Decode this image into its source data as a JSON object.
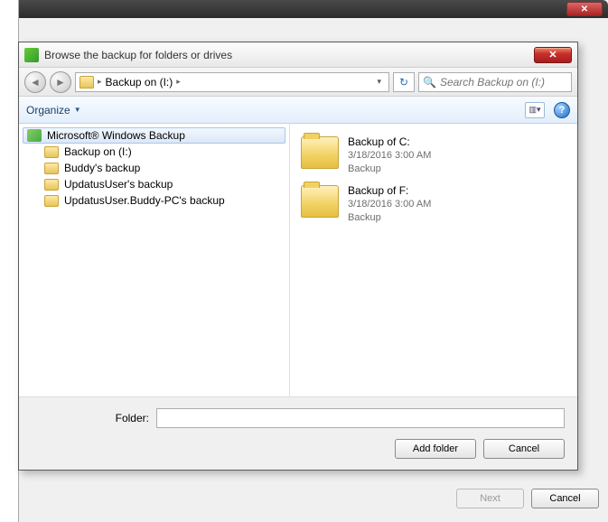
{
  "outerWindow": {
    "closeGlyph": "✕",
    "buttons": {
      "next": "Next",
      "cancel": "Cancel"
    }
  },
  "dialog": {
    "title": "Browse the backup for folders or drives",
    "closeGlyph": "✕"
  },
  "nav": {
    "backGlyph": "◄",
    "fwdGlyph": "►",
    "crumbSep": "▸",
    "location": "Backup on (I:)",
    "dropdownGlyph": "▾",
    "refreshGlyph": "↻",
    "search": {
      "icon": "🔍",
      "placeholder": "Search Backup on (I:)"
    }
  },
  "toolbar": {
    "organize": "Organize",
    "organizeGlyph": "▼",
    "viewGlyph": "▥▾",
    "helpGlyph": "?"
  },
  "tree": {
    "root": "Microsoft® Windows Backup",
    "children": [
      "Backup on (I:)",
      "Buddy's backup",
      "UpdatusUser's backup",
      "UpdatusUser.Buddy-PC's backup"
    ]
  },
  "items": [
    {
      "name": "Backup of C:",
      "date": "3/18/2016 3:00 AM",
      "type": "Backup"
    },
    {
      "name": "Backup of F:",
      "date": "3/18/2016 3:00 AM",
      "type": "Backup"
    }
  ],
  "footer": {
    "folderLabel": "Folder:",
    "folderValue": "",
    "addFolder": "Add folder",
    "cancel": "Cancel"
  }
}
